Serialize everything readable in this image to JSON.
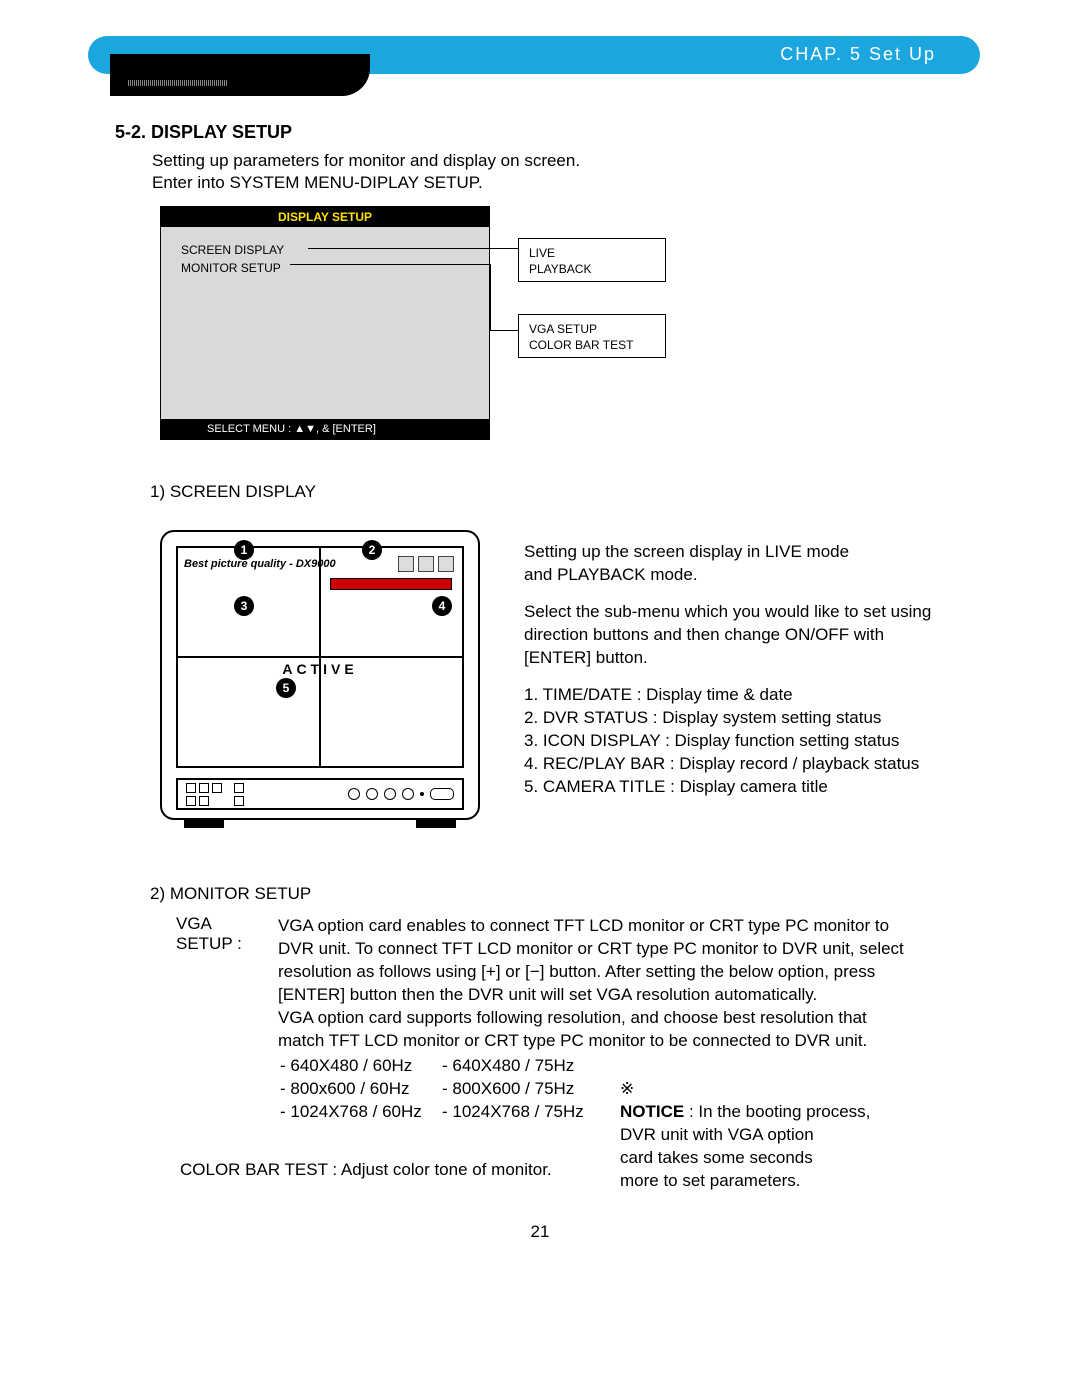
{
  "header": {
    "chapter": "CHAP.  5  Set Up"
  },
  "section": {
    "number_title": "5-2. DISPLAY SETUP",
    "intro": "Setting up parameters for monitor and display on screen.\nEnter into SYSTEM MENU-DIPLAY SETUP."
  },
  "menu": {
    "title": "DISPLAY SETUP",
    "items": [
      "SCREEN DISPLAY",
      "MONITOR SETUP"
    ],
    "footer": "SELECT MENU : ▲▼, & [ENTER]"
  },
  "callouts": {
    "box1": [
      "LIVE",
      "PLAYBACK"
    ],
    "box2": [
      "VGA SETUP",
      "COLOR BAR TEST"
    ]
  },
  "screen_display": {
    "heading": "1) SCREEN DISPLAY",
    "osd_text": "Best picture quality - DX9000",
    "camera_title": "ACTIVE",
    "badges": [
      "1",
      "2",
      "3",
      "4",
      "5"
    ],
    "para1": "Setting up the screen display in LIVE mode\nand PLAYBACK mode.",
    "para2": "Select the sub-menu which you would like to set using\ndirection buttons and then change ON/OFF with\n[ENTER] button.",
    "list": [
      "1. TIME/DATE : Display time & date",
      "2. DVR STATUS : Display system setting status",
      "3. ICON DISPLAY : Display function setting status",
      "4. REC/PLAY BAR : Display record / playback status",
      "5. CAMERA TITLE : Display camera title"
    ]
  },
  "monitor_setup": {
    "heading": "2) MONITOR SETUP",
    "vga_label": "VGA SETUP :",
    "vga_body": "VGA option card enables to connect TFT LCD monitor or CRT type PC monitor to\nDVR unit. To connect TFT LCD monitor or CRT type PC monitor to DVR unit, select\nresolution as follows using  [+] or [−] button. After setting the below option, press\n[ENTER] button then the DVR unit will set VGA resolution automatically.\nVGA option card supports following resolution, and choose best resolution that\nmatch TFT LCD monitor or CRT type PC monitor to be connected to DVR unit.",
    "res_col1": [
      "- 640X480 / 60Hz",
      "- 800x600 / 60Hz",
      "- 1024X768 / 60Hz"
    ],
    "res_col2": [
      "- 640X480 / 75Hz",
      "- 800X600 / 75Hz",
      "- 1024X768 / 75Hz"
    ],
    "notice_symbol": "※",
    "notice_bold": "NOTICE",
    "notice_rest": " : In the booting process,\n           DVR unit with VGA option\n           card takes some seconds\n           more to set parameters.",
    "color_bar": "COLOR BAR TEST : Adjust color tone of monitor."
  },
  "page_number": "21"
}
